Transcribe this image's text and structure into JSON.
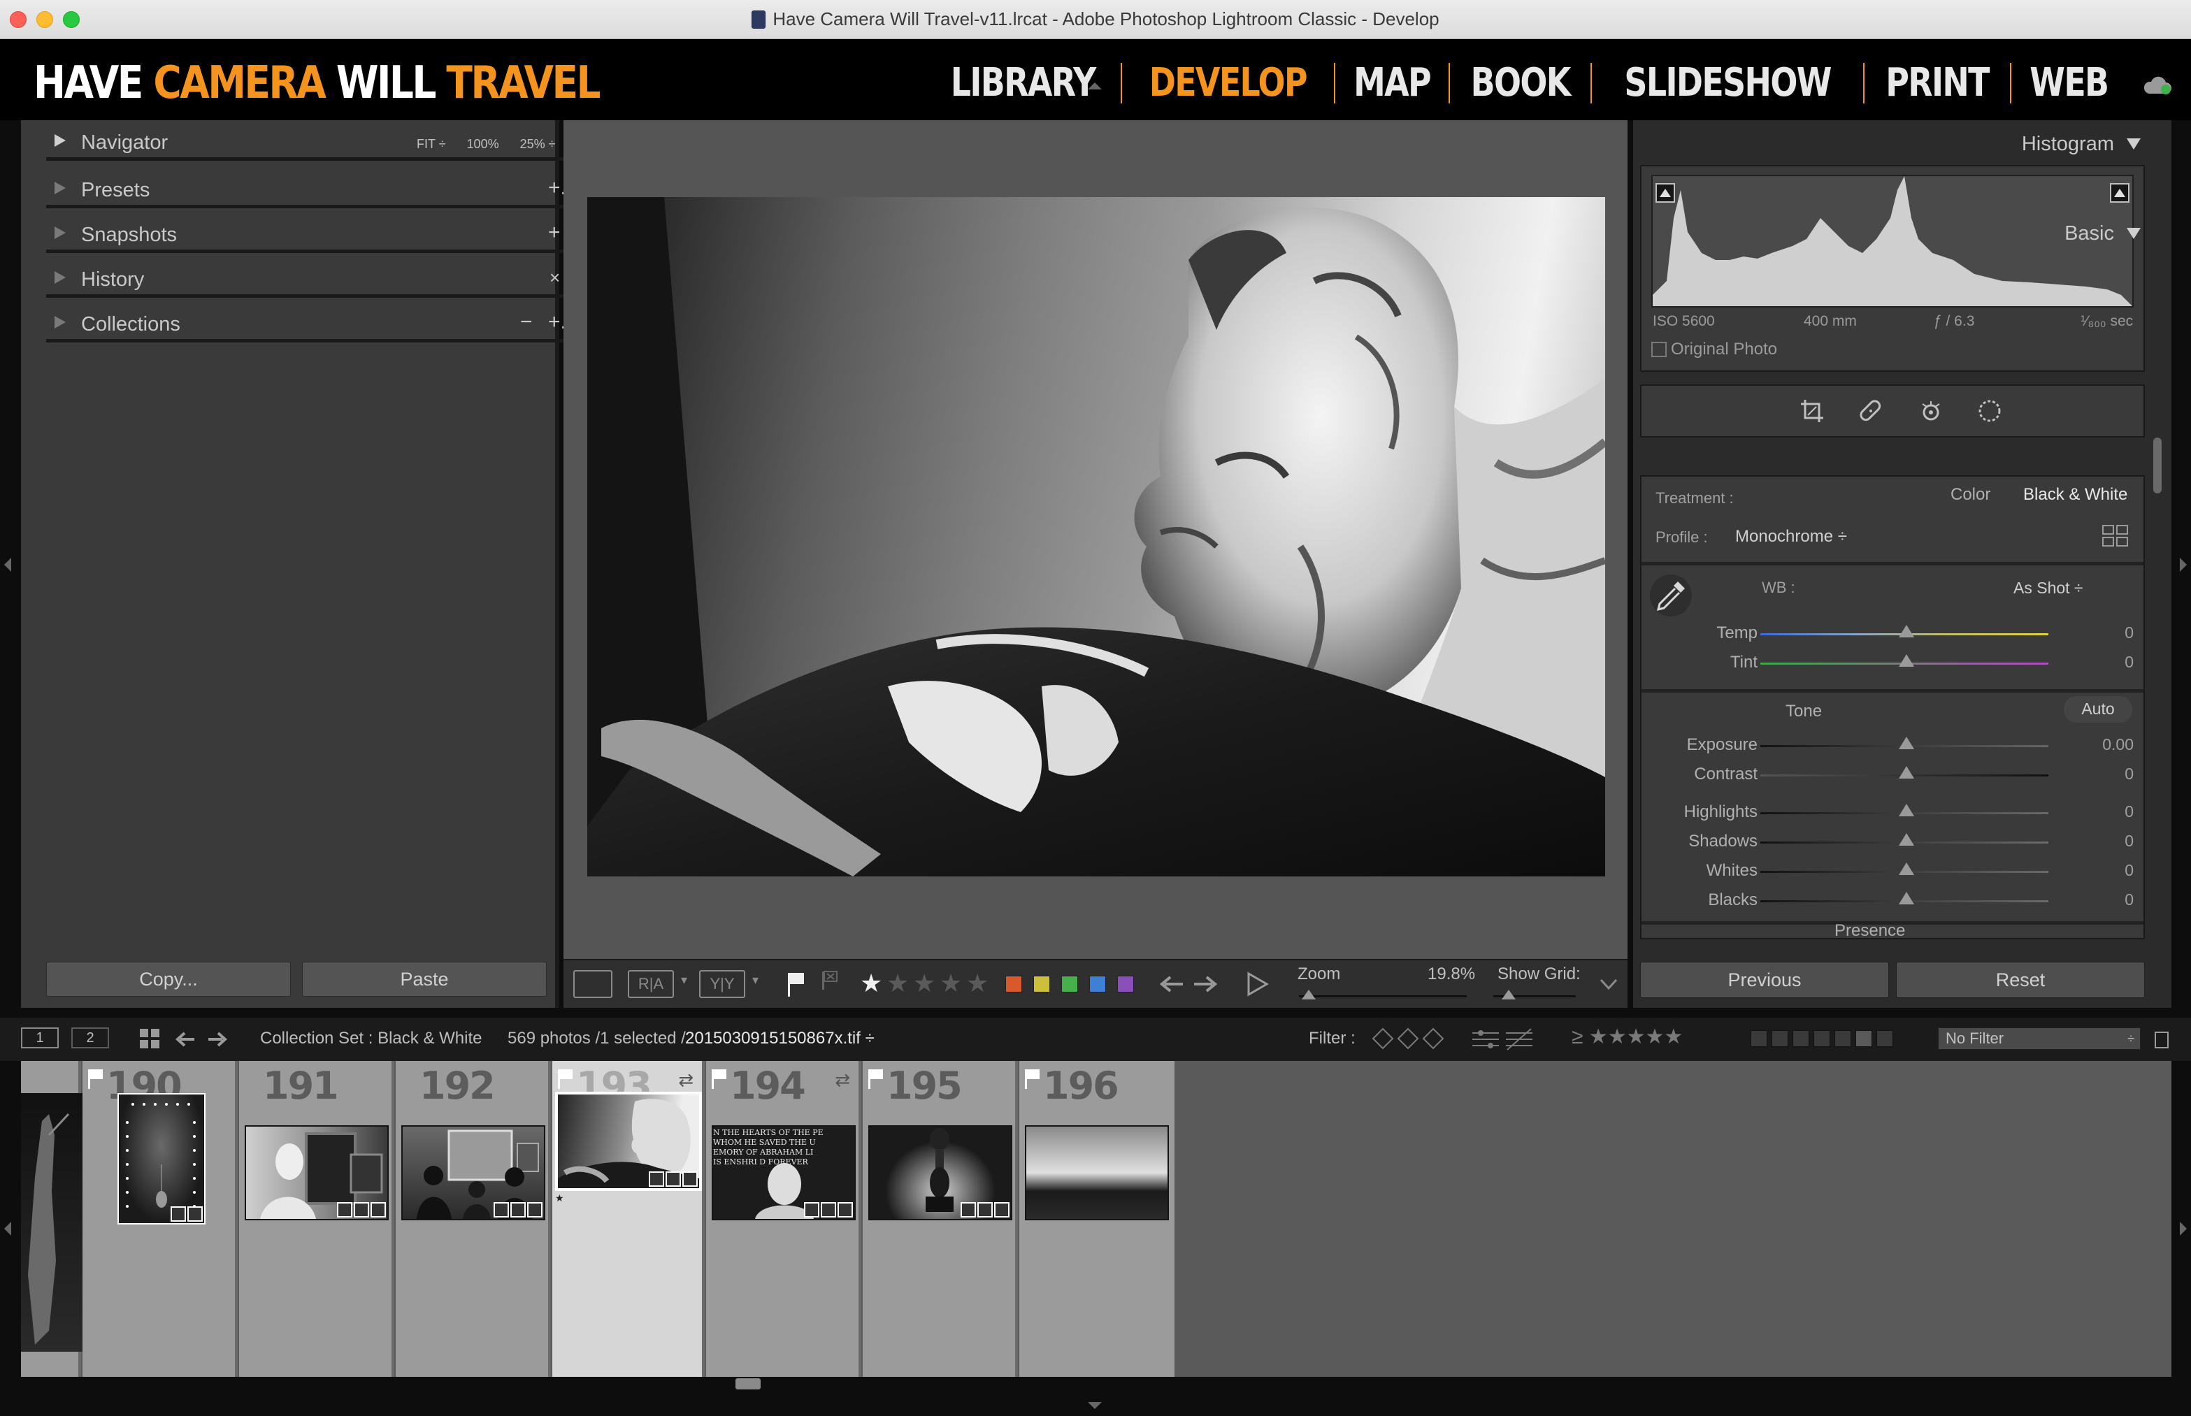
{
  "window": {
    "title": "Have Camera Will Travel-v11.lrcat - Adobe Photoshop Lightroom Classic - Develop"
  },
  "identity": {
    "brand_1": "HAVE",
    "brand_2": "CAMERA",
    "brand_3": "WILL",
    "brand_4": "TRAVEL",
    "modules": [
      "LIBRARY",
      "DEVELOP",
      "MAP",
      "BOOK",
      "SLIDESHOW",
      "PRINT",
      "WEB"
    ],
    "active_module": "DEVELOP"
  },
  "left_panel": {
    "navigator": {
      "label": "Navigator",
      "opt_fit": "FIT ÷",
      "opt_100": "100%",
      "opt_25": "25% ÷"
    },
    "presets": {
      "label": "Presets",
      "action": "+."
    },
    "snapshots": {
      "label": "Snapshots",
      "action": "+"
    },
    "history": {
      "label": "History",
      "action": "×"
    },
    "collections": {
      "label": "Collections",
      "action_minus": "−",
      "action_plus": "+."
    },
    "copy_label": "Copy...",
    "paste_label": "Paste"
  },
  "toolbar": {
    "view_loupe": "",
    "view_ra": "R|A",
    "view_yy": "Y|Y",
    "colors": [
      "#d85a2a",
      "#cbbf3c",
      "#46b04a",
      "#3f7fd4",
      "#8a4fb8"
    ],
    "zoom_label": "Zoom",
    "zoom_value": "19.8%",
    "zoom_level": 0.06,
    "grid_label": "Show Grid:",
    "rating": 1
  },
  "histogram": {
    "title": "Histogram",
    "iso": "ISO 5600",
    "focal": "400 mm",
    "aperture": "ƒ / 6.3",
    "shutter": "¹⁄₈₀₀ sec",
    "original_photo": "Original Photo"
  },
  "basic": {
    "title": "Basic",
    "treatment_label": "Treatment :",
    "treatment_color": "Color",
    "treatment_bw": "Black & White",
    "profile_label": "Profile :",
    "profile_value": "Monochrome ÷",
    "wb_label": "WB :",
    "wb_value": "As Shot ÷",
    "tone_label": "Tone",
    "auto_label": "Auto",
    "presence_label": "Presence",
    "sliders": [
      {
        "label": "Temp",
        "value": "0"
      },
      {
        "label": "Tint",
        "value": "0"
      },
      {
        "label": "Exposure",
        "value": "0.00"
      },
      {
        "label": "Contrast",
        "value": "0"
      },
      {
        "label": "Highlights",
        "value": "0"
      },
      {
        "label": "Shadows",
        "value": "0"
      },
      {
        "label": "Whites",
        "value": "0"
      },
      {
        "label": "Blacks",
        "value": "0"
      }
    ],
    "previous_label": "Previous",
    "reset_label": "Reset"
  },
  "filmbar": {
    "screen_1": "1",
    "screen_2": "2",
    "source": "Collection Set : Black & White",
    "count": "569 photos /1 selected /",
    "filename": "2015030915150867x.tif ÷",
    "filter_label": "Filter :",
    "filter_rating": "≥ ★★★★★",
    "no_filter": "No Filter"
  },
  "filmstrip": {
    "cells": [
      {
        "num": "190"
      },
      {
        "num": "191"
      },
      {
        "num": "192"
      },
      {
        "num": "193"
      },
      {
        "num": "194"
      },
      {
        "num": "195"
      },
      {
        "num": "196"
      }
    ],
    "inscription": [
      "N THE HEARTS OF THE PE",
      "WHOM HE SAVED THE U",
      "EMORY OF ABRAHAM LI",
      "IS ENSHRI  D FOREVER"
    ],
    "selected_star": "★"
  }
}
